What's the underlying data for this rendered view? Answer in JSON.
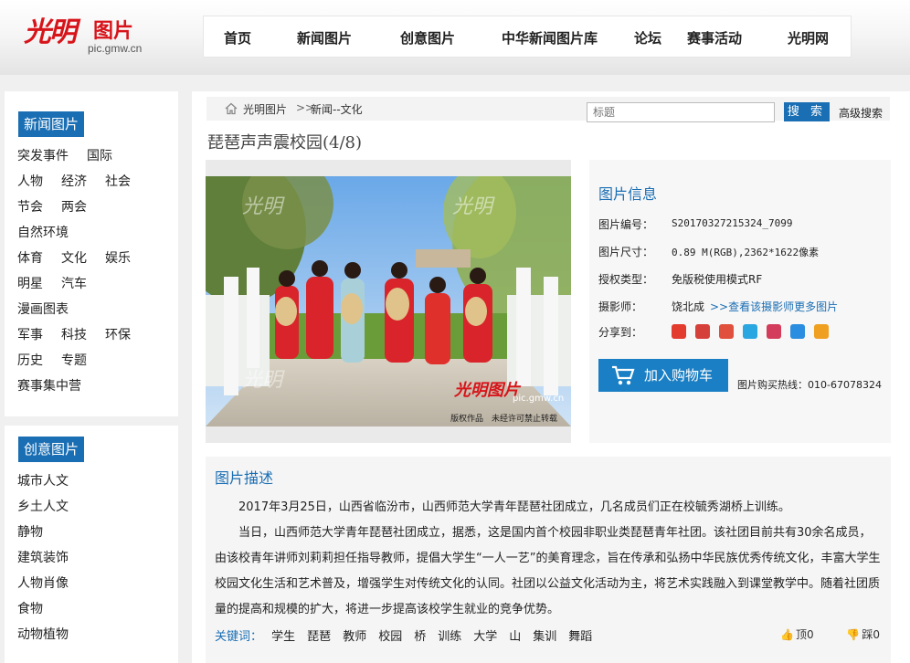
{
  "brand": {
    "mark": "光明",
    "name": "图片",
    "domain": "pic.gmw.cn"
  },
  "nav": [
    "首页",
    "新闻图片",
    "创意图片",
    "中华新闻图片库",
    "论坛",
    "赛事活动",
    "光明网"
  ],
  "sidebar_news": {
    "title": "新闻图片",
    "rows": [
      [
        "突发事件",
        "国际"
      ],
      [
        "人物",
        "经济",
        "社会"
      ],
      [
        "节会",
        "两会"
      ],
      [
        "自然环境"
      ],
      [
        "体育",
        "文化",
        "娱乐"
      ],
      [
        "明星",
        "汽车"
      ],
      [
        "漫画图表"
      ],
      [
        "军事",
        "科技",
        "环保"
      ],
      [
        "历史",
        "专题"
      ],
      [
        "赛事集中营"
      ]
    ]
  },
  "sidebar_creative": {
    "title": "创意图片",
    "rows": [
      [
        "城市人文"
      ],
      [
        "乡土人文"
      ],
      [
        "静物"
      ],
      [
        "建筑装饰"
      ],
      [
        "人物肖像"
      ],
      [
        "食物"
      ],
      [
        "动物植物"
      ]
    ]
  },
  "breadcrumb": {
    "home": "光明图片",
    "sep": ">>",
    "section": "新闻--文化"
  },
  "search": {
    "placeholder": "标题",
    "button": "搜 索",
    "advanced": "高级搜索"
  },
  "page_title": "琵琶声声震校园(4/8)",
  "photo": {
    "watermark_brand": "光明图片",
    "watermark_domain": "pic.gmw.cn",
    "copyright": "版权作品　未经许可禁止转载"
  },
  "info": {
    "title": "图片信息",
    "id_label": "图片编号：",
    "id_value": "S20170327215324_7099",
    "size_label": "图片尺寸：",
    "size_value": "0.89 M(RGB),2362*1622像素",
    "license_label": "授权类型：",
    "license_value": "免版税使用模式RF",
    "photographer_label": "摄影师：",
    "photographer_value": "饶北成",
    "more_link": ">>查看该摄影师更多图片",
    "share_label": "分享到：",
    "cart_button": "加入购物车",
    "hotline": "图片购买热线：010-67078324"
  },
  "share_icons": [
    {
      "name": "gmw-share-icon",
      "color": "#e33b2e"
    },
    {
      "name": "renren-share-icon",
      "color": "#d6403a"
    },
    {
      "name": "weibo-share-icon",
      "color": "#e0503c"
    },
    {
      "name": "tencent-share-icon",
      "color": "#2aa6e0"
    },
    {
      "name": "kaixin-share-icon",
      "color": "#d33c5a"
    },
    {
      "name": "qzone-share-icon",
      "color": "#2b8ddf"
    },
    {
      "name": "douban-share-icon",
      "color": "#f0a020"
    }
  ],
  "description": {
    "title": "图片描述",
    "paragraphs": [
      "2017年3月25日，山西省临汾市，山西师范大学青年琵琶社团成立，几名成员们正在校毓秀湖桥上训练。",
      "当日，山西师范大学青年琵琶社团成立，据悉，这是国内首个校园非职业类琵琶青年社团。该社团目前共有30余名成员，由该校青年讲师刘莉莉担任指导教师，提倡大学生“一人一艺”的美育理念，旨在传承和弘扬中华民族优秀传统文化，丰富大学生校园文化生活和艺术普及，增强学生对传统文化的认同。社团以公益文化活动为主，将艺术实践融入到课堂教学中。随着社团质量的提高和规模的扩大，将进一步提高该校学生就业的竞争优势。"
    ],
    "keywords_label": "关键词：",
    "keywords": [
      "学生",
      "琵琶",
      "教师",
      "校园",
      "桥",
      "训练",
      "大学",
      "山",
      "集训",
      "舞蹈"
    ],
    "up": "顶0",
    "down": "踩0"
  }
}
